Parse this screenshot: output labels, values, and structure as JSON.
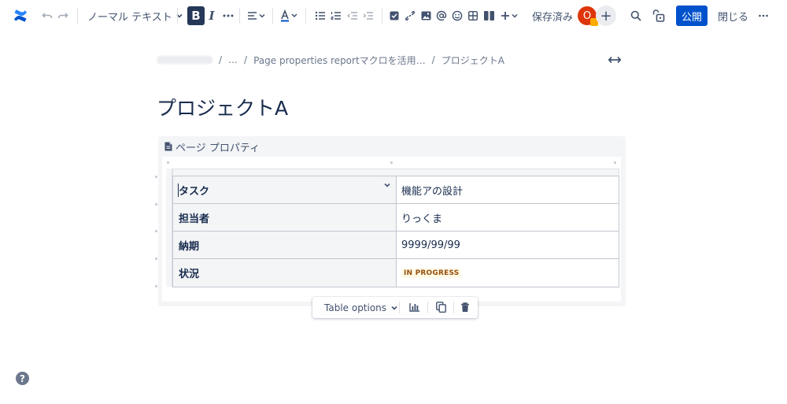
{
  "toolbar": {
    "text_style": "ノーマル テキスト",
    "bold_label": "B",
    "italic_label": "I",
    "saved_status": "保存済み",
    "avatar_initial": "O",
    "add_label": "+",
    "publish_label": "公開",
    "close_label": "閉じる"
  },
  "breadcrumb": {
    "ellipsis": "…",
    "parent": "Page properties reportマクロを活用…",
    "current": "プロジェクトA",
    "separator": "/"
  },
  "page": {
    "title": "プロジェクトA"
  },
  "macro": {
    "title": "ページ プロパティ",
    "rows": [
      {
        "key": "タスク",
        "value": "機能アの設計"
      },
      {
        "key": "担当者",
        "value": "りっくま"
      },
      {
        "key": "納期",
        "value": "9999/99/99"
      },
      {
        "key": "状況",
        "status": "IN PROGRESS"
      }
    ]
  },
  "table_toolbar": {
    "options_label": "Table options"
  },
  "help_label": "?",
  "colors": {
    "brand_blue": "#0052cc",
    "status_bg": "#fffae6",
    "status_text": "#974f0c",
    "avatar_bg": "#de350b"
  },
  "icons": [
    "confluence-logo-icon",
    "undo-icon",
    "redo-icon",
    "chevron-down-icon",
    "more-icon",
    "align-icon",
    "text-color-icon",
    "bullet-list-icon",
    "numbered-list-icon",
    "outdent-icon",
    "indent-icon",
    "task-icon",
    "link-icon",
    "image-icon",
    "mention-icon",
    "emoji-icon",
    "table-icon",
    "layout-icon",
    "insert-icon",
    "search-icon",
    "restrictions-icon",
    "width-toggle-icon",
    "page-icon",
    "chart-icon",
    "copy-icon",
    "trash-icon",
    "help-icon"
  ]
}
